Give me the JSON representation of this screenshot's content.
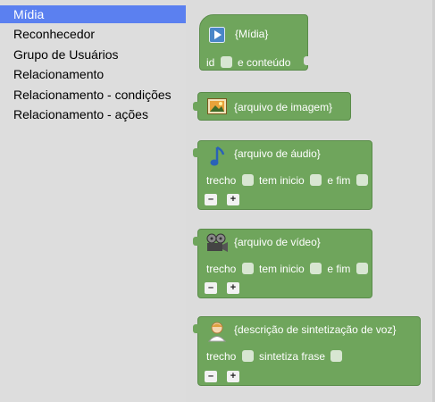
{
  "toolbox": {
    "categories": [
      {
        "label": "Mídia",
        "selected": true
      },
      {
        "label": "Reconhecedor",
        "selected": false
      },
      {
        "label": "Grupo de Usuários",
        "selected": false
      },
      {
        "label": "Relacionamento",
        "selected": false
      },
      {
        "label": "Relacionamento - condições",
        "selected": false
      },
      {
        "label": "Relacionamento - ações",
        "selected": false
      }
    ]
  },
  "blocks": {
    "midia": {
      "title": "{Mídia}",
      "id_label": "id",
      "content_label": "e conteúdo",
      "icon": "play-icon"
    },
    "image": {
      "title": "{arquivo de imagem}",
      "icon": "picture-icon"
    },
    "audio": {
      "title": "{arquivo de áudio}",
      "trecho_label": "trecho",
      "start_label": "tem inicio",
      "end_label": "e fim",
      "minus_label": "–",
      "plus_label": "+",
      "icon": "music-note-icon"
    },
    "video": {
      "title": "{arquivo de vídeo}",
      "trecho_label": "trecho",
      "start_label": "tem inicio",
      "end_label": "e fim",
      "minus_label": "–",
      "plus_label": "+",
      "icon": "film-reel-icon"
    },
    "speech": {
      "title": "{descrição de sintetização de voz}",
      "trecho_label": "trecho",
      "synth_label": "sintetiza frase",
      "minus_label": "–",
      "plus_label": "+",
      "icon": "speaker-person-icon"
    }
  },
  "colors": {
    "block_green": "#6fa55c",
    "selected_blue": "#5b80f0",
    "toolbox_bg": "#dddddd"
  }
}
